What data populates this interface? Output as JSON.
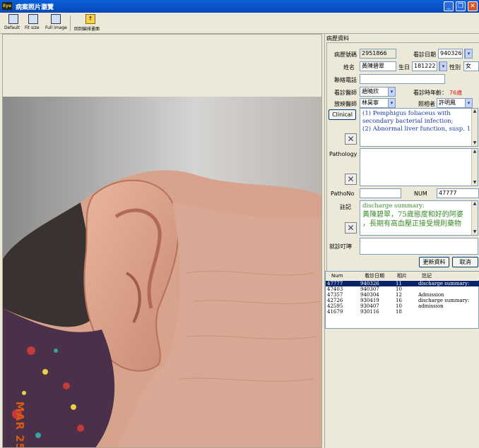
{
  "window": {
    "app_icon": "Eye",
    "title": "病案照片瀏覽"
  },
  "toolbar": {
    "default_label": "Default",
    "fit_size_label": "Fit size",
    "full_image_label": "Full image",
    "back_label": "回到編排畫面"
  },
  "photo": {
    "date_stamp": "MAR 25"
  },
  "record": {
    "group_title": "病歷資料",
    "chart_no_label": "病歷號碼",
    "chart_no": "2951866",
    "visit_date_label": "看診日期",
    "visit_date": "940326",
    "name_label": "姓名",
    "name": "黃陳碧翠",
    "birth_label": "生日",
    "birth": "181222",
    "sex_label": "性別",
    "sex": "女",
    "phone_label": "聯絡電話",
    "phone": "",
    "doctor_label": "看診醫師",
    "doctor": "趙曉欣",
    "age_label": "看診時年齡：",
    "age": "76歲",
    "radiologist_label": "放映醫師",
    "radiologist": "林昊寧",
    "photographer_label": "照相者",
    "photographer": "許明鳳",
    "clinical_button": "Clinical",
    "clinical_text": "(1) Pemphigus foliaceus with\nsecondary bacterial infection;\n(2) Abnormal liver function, susp. 1.",
    "pathology_label": "Pathology",
    "pathology_text": "",
    "pathono_label": "PathoNo",
    "pathono": "",
    "num_label": "NUM",
    "num": "47777",
    "note_label": "註記",
    "note_text_1": "discharge summary:",
    "note_text_2": "黃陳碧翠，75歲態度和好的阿婆\n，長期有高血壓正接受規則藥物",
    "advice_label": "就診叮嚀",
    "advice_text": "",
    "update_button": "更新資料",
    "cancel_button": "取消"
  },
  "table": {
    "headers": [
      "Num",
      "看診日期",
      "相片",
      "註記"
    ],
    "rows": [
      [
        "47777",
        "940326",
        "11",
        "discharge summary:"
      ],
      [
        "47403",
        "940307",
        "10",
        ""
      ],
      [
        "47357",
        "940304",
        "12",
        "Admission"
      ],
      [
        "42726",
        "930419",
        "16",
        "discharge summary:"
      ],
      [
        "42595",
        "930407",
        "10",
        "admission"
      ],
      [
        "41679",
        "930116",
        "18",
        ""
      ]
    ]
  }
}
